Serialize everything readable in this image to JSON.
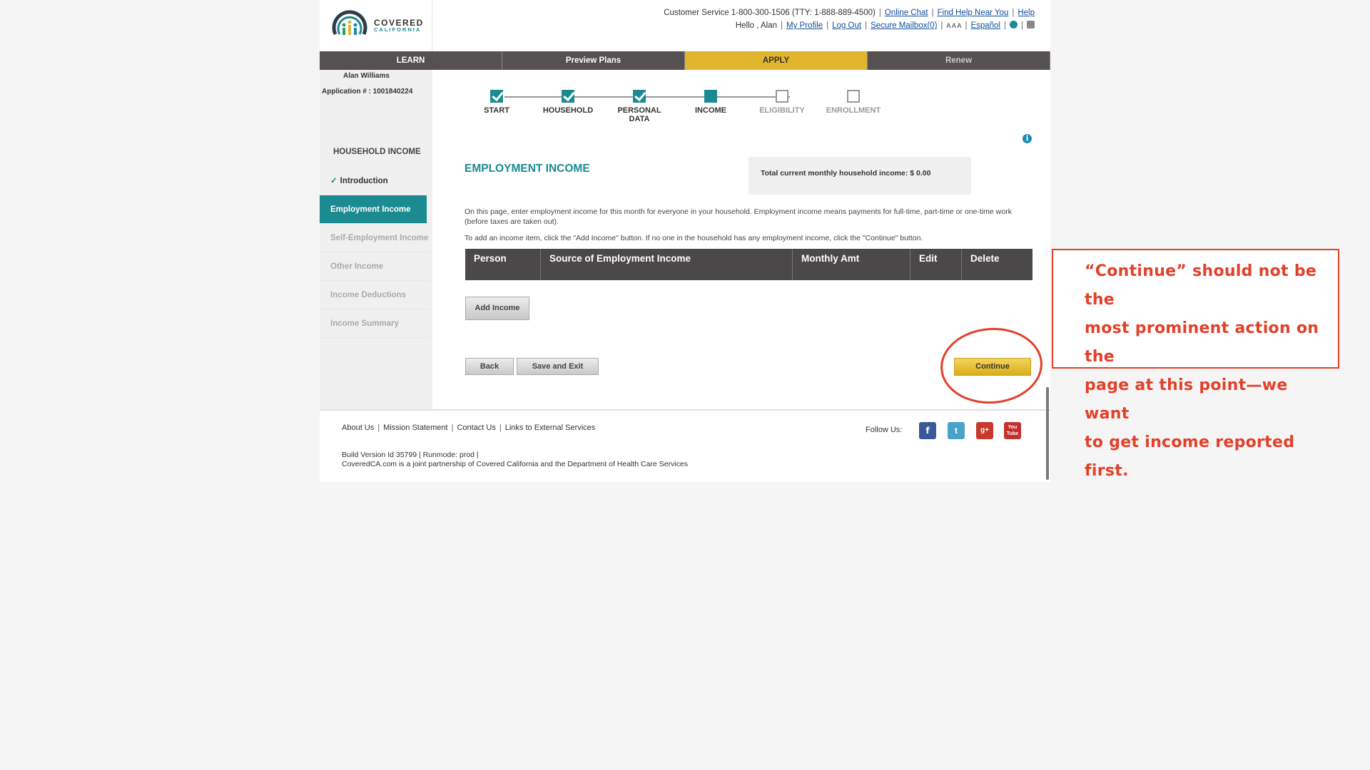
{
  "header": {
    "brand_line1": "COVERED",
    "brand_line2": "CALIFORNIA",
    "customer_service": "Customer Service 1-800-300-1506 (TTY: 1-888-889-4500)",
    "online_chat": "Online Chat",
    "find_help": "Find Help Near You",
    "help": "Help",
    "greeting": "Hello , Alan",
    "my_profile": "My Profile",
    "log_out": "Log Out",
    "secure_mailbox": "Secure Mailbox(0)",
    "font_size": "A A A",
    "espanol": "Español"
  },
  "nav": {
    "learn": "LEARN",
    "preview": "Preview Plans",
    "apply": "APPLY",
    "renew": "Renew"
  },
  "sidebar": {
    "user": "Alan Williams",
    "application": "Application # : 1001840224",
    "title": "HOUSEHOLD INCOME",
    "items": [
      {
        "label": "Introduction"
      },
      {
        "label": "Employment Income"
      },
      {
        "label": "Self-Employment Income"
      },
      {
        "label": "Other Income"
      },
      {
        "label": "Income Deductions"
      },
      {
        "label": "Income Summary"
      }
    ]
  },
  "stepper": {
    "steps": [
      {
        "label": "START",
        "state": "done"
      },
      {
        "label": "HOUSEHOLD",
        "state": "done"
      },
      {
        "label": "PERSONAL DATA",
        "state": "done"
      },
      {
        "label": "INCOME",
        "state": "current"
      },
      {
        "label": "ELIGIBILITY",
        "state": "todo"
      },
      {
        "label": "ENROLLMENT",
        "state": "todo"
      }
    ]
  },
  "main": {
    "title": "EMPLOYMENT INCOME",
    "total": "Total current monthly household income: $ 0.00",
    "desc1": "On this page, enter employment income for this month for everyone in your household. Employment income means payments for full-time, part-time or one-time work (before taxes are taken out).",
    "desc2": "To add an income item, click the \"Add Income\" button. If no one in the household has any employment income, click the \"Continue\" button.",
    "table_headers": [
      "Person",
      "Source of Employment Income",
      "Monthly Amt",
      "Edit",
      "Delete"
    ],
    "add_income": "Add Income",
    "back": "Back",
    "save_exit": "Save and Exit",
    "continue": "Continue"
  },
  "footer": {
    "links": [
      "About Us",
      "Mission Statement",
      "Contact Us",
      "Links to External Services"
    ],
    "build": "Build Version Id 35799 |   Runmode: prod  |",
    "partner": "CoveredCA.com is a joint partnership of Covered California and the Department of Health Care Services",
    "follow": "Follow Us:",
    "social": {
      "facebook": "f",
      "twitter": "t",
      "googleplus": "g+",
      "youtube": "You Tube"
    }
  },
  "annotation": {
    "lines": [
      "“Continue” should not be the",
      "most prominent action on the",
      "page at this point—we want",
      "to get income reported first."
    ]
  },
  "colors": {
    "accent": "#1b8a91",
    "apply_tab": "#e2b52f",
    "annotation": "#e2402a"
  }
}
